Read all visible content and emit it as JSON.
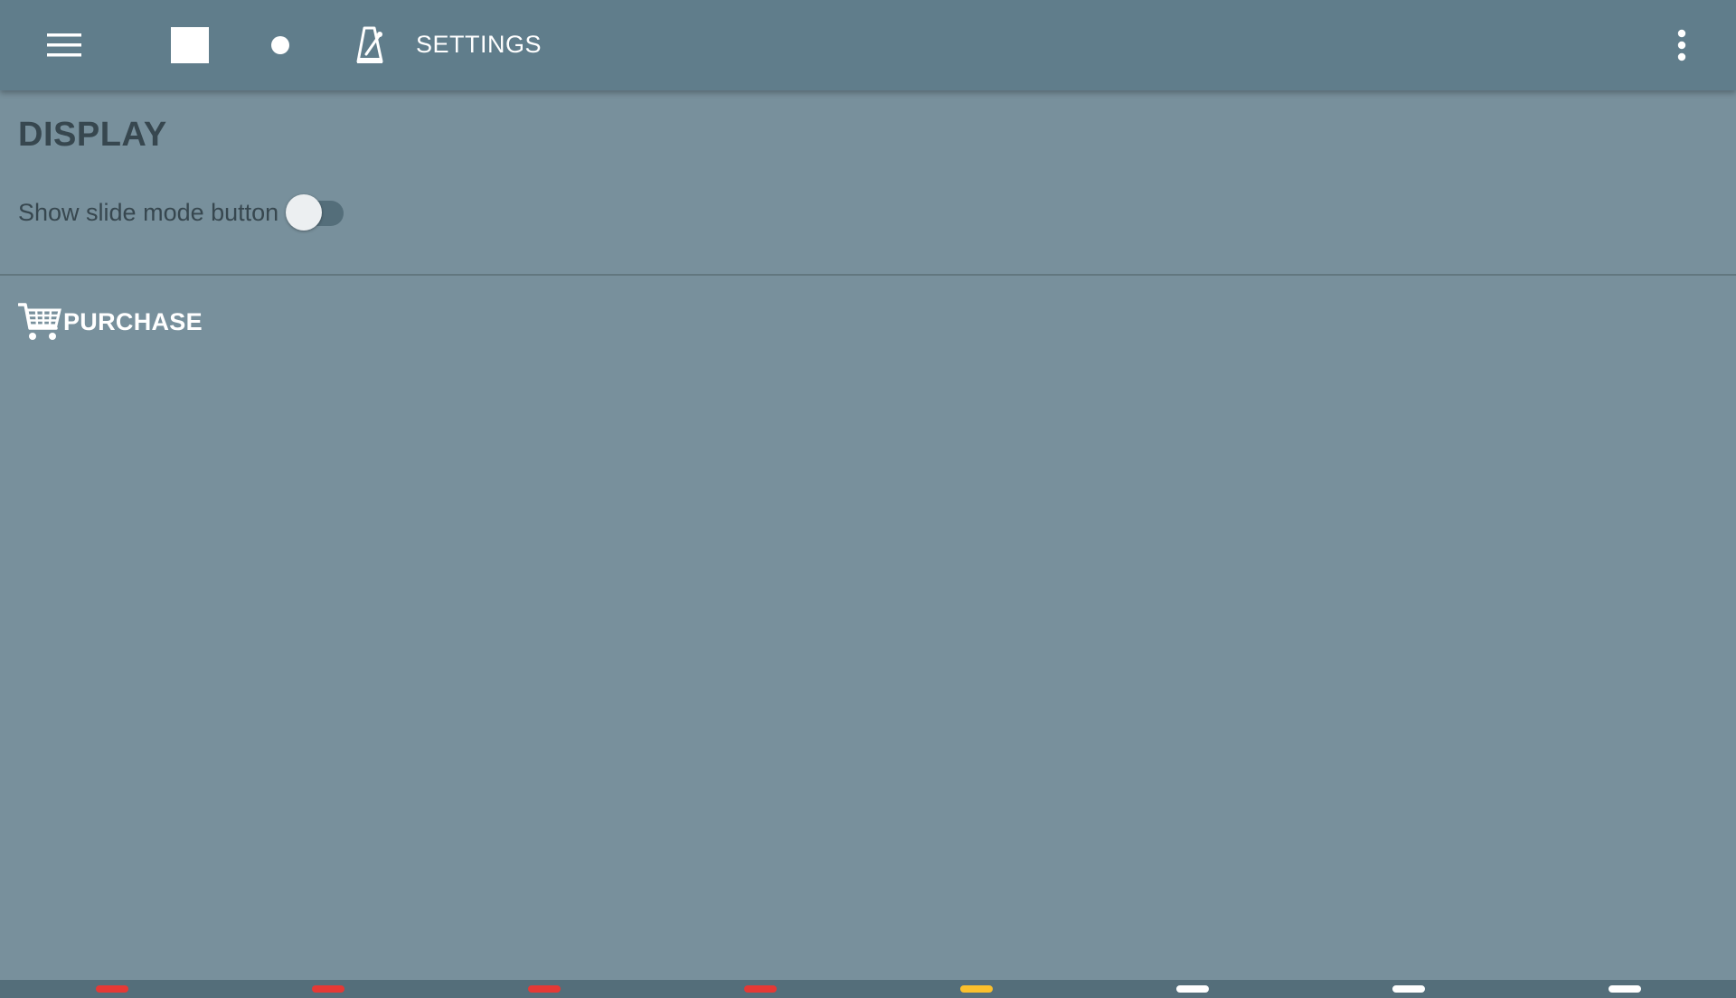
{
  "toolbar": {
    "title": "SETTINGS",
    "icons": {
      "menu": "menu-icon",
      "stop": "stop-icon",
      "record": "record-icon",
      "metronome": "metronome-icon",
      "overflow": "more-vert-icon"
    }
  },
  "display_section": {
    "title": "DISPLAY",
    "slide_mode": {
      "label": "Show slide mode button",
      "enabled": false
    }
  },
  "purchase": {
    "label": "PURCHASE",
    "icon": "shopping-cart-icon"
  },
  "beat_indicators": [
    {
      "color": "#e53935"
    },
    {
      "color": "#e53935"
    },
    {
      "color": "#e53935"
    },
    {
      "color": "#e53935"
    },
    {
      "color": "#fbc02d"
    },
    {
      "color": "#ffffff"
    },
    {
      "color": "#ffffff"
    },
    {
      "color": "#ffffff"
    }
  ],
  "colors": {
    "background": "#78909c",
    "toolbar": "#607d8b",
    "section_text": "#37474f",
    "accent_red": "#e53935",
    "accent_yellow": "#fbc02d"
  }
}
